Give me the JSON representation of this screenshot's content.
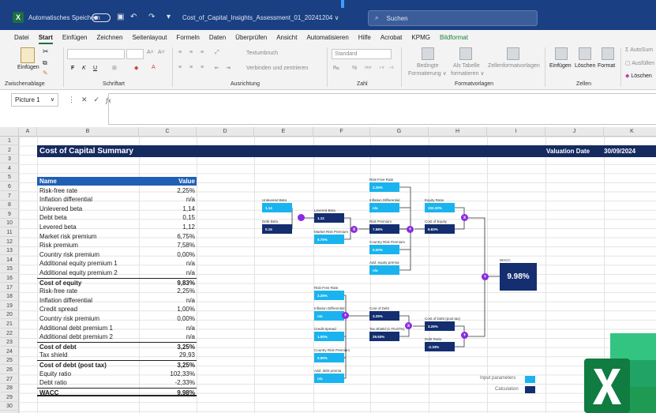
{
  "titlebar": {
    "logo": "X",
    "autosave_label": "Automatisches Speichern",
    "doc_name": "Cost_of_Capital_Insights_Assessment_01_20241204 ∨",
    "search_placeholder": "Suchen",
    "bg_color": "#1a3f82"
  },
  "menu": [
    "Datei",
    "Start",
    "Einfügen",
    "Zeichnen",
    "Seitenlayout",
    "Formeln",
    "Daten",
    "Überprüfen",
    "Ansicht",
    "Automatisieren",
    "Hilfe",
    "Acrobat",
    "KPMG",
    "Bildformat"
  ],
  "menu_active": "Start",
  "ribbon": {
    "paste": "Einfügen",
    "group_clipboard": "Zwischenablage",
    "group_font": "Schriftart",
    "group_align": "Ausrichtung",
    "group_number": "Zahl",
    "group_styles": "Formatvorlagen",
    "group_cells": "Zellen",
    "wrap_text": "Textumbruch",
    "merge": "Verbinden und zentrieren",
    "number_format": "Standard",
    "cond_format_1": "Bedingte",
    "cond_format_2": "Formatierung ∨",
    "as_table_1": "Als Tabelle",
    "as_table_2": "formatieren ∨",
    "cell_styles": "Zellenformatvorlagen",
    "insert": "Einfügen",
    "delete": "Löschen",
    "format": "Format",
    "autosum": "AutoSum",
    "fill": "Ausfüllen",
    "clear": "Löschen",
    "font_letters": {
      "bold": "F",
      "italic": "K",
      "underline": "U"
    }
  },
  "formula": {
    "name_box": "Picture 1",
    "fx": "fx"
  },
  "columns": [
    "A",
    "B",
    "C",
    "D",
    "E",
    "F",
    "G",
    "H",
    "I",
    "J",
    "K"
  ],
  "rows": [
    "1",
    "2",
    "3",
    "4",
    "5",
    "6",
    "7",
    "8",
    "9",
    "10",
    "11",
    "12",
    "13",
    "14",
    "15",
    "16",
    "17",
    "18",
    "19",
    "20",
    "21",
    "22",
    "23",
    "24",
    "25",
    "26",
    "27",
    "28",
    "29",
    "30"
  ],
  "sheet": {
    "title": "Cost of Capital Summary",
    "valuation_label": "Valuation Date",
    "valuation_date": "30/09/2024",
    "header_name": "Name",
    "header_value": "Value",
    "rows": [
      {
        "n": "Risk-free rate",
        "v": "2,25%"
      },
      {
        "n": "Inflation differential",
        "v": "n/a"
      },
      {
        "n": "Unlevered beta",
        "v": "1,14"
      },
      {
        "n": "Debt beta",
        "v": "0,15"
      },
      {
        "n": "Levered beta",
        "v": "1,12"
      },
      {
        "n": "Market risk premium",
        "v": "6,75%"
      },
      {
        "n": "Risk premium",
        "v": "7,58%"
      },
      {
        "n": "Country risk premium",
        "v": "0,00%"
      },
      {
        "n": "Additional equity premium 1",
        "v": "n/a"
      },
      {
        "n": "Additional equity premium 2",
        "v": "n/a"
      },
      {
        "n": "Cost of equity",
        "v": "9,83%",
        "bold": true
      },
      {
        "n": "Risk-free rate",
        "v": "2,25%"
      },
      {
        "n": "Inflation differential",
        "v": "n/a"
      },
      {
        "n": "Credit spread",
        "v": "1,00%"
      },
      {
        "n": "Country risk premium",
        "v": "0,00%"
      },
      {
        "n": "Additional debt premium 1",
        "v": "n/a"
      },
      {
        "n": "Additional debt premium 2",
        "v": "n/a"
      },
      {
        "n": "Cost of debt",
        "v": "3,25%",
        "bold": true
      },
      {
        "n": "Tax shield",
        "v": "29,93"
      },
      {
        "n": "Cost of debt (post tax)",
        "v": "3,25%",
        "bold": true
      },
      {
        "n": "Equity ratio",
        "v": "102,33%"
      },
      {
        "n": "Debt ratio",
        "v": "-2,33%"
      },
      {
        "n": "WACC",
        "v": "9,98%",
        "bold": true,
        "last": true
      }
    ]
  },
  "tree": {
    "boxes": [
      {
        "id": "unlev",
        "label": "Unlevered Beta",
        "value": "1.14",
        "kind": "input"
      },
      {
        "id": "debtbeta",
        "label": "Debt Beta",
        "value": "0.15",
        "kind": "calc"
      },
      {
        "id": "lev",
        "label": "Levered Beta",
        "value": "1.12",
        "kind": "calc"
      },
      {
        "id": "mrp",
        "label": "Market Risk Premium",
        "value": "6.75%",
        "kind": "input"
      },
      {
        "id": "rf1",
        "label": "Risk-Free Rate",
        "value": "2.25%",
        "kind": "input"
      },
      {
        "id": "infl1",
        "label": "Inflation Differential",
        "value": "n/a",
        "kind": "input"
      },
      {
        "id": "rp",
        "label": "Risk Premium",
        "value": "7.58%",
        "kind": "calc"
      },
      {
        "id": "crp1",
        "label": "Country Risk Premium",
        "value": "0.00%",
        "kind": "input"
      },
      {
        "id": "add1",
        "label": "Add. equity premia",
        "value": "n/a",
        "kind": "input"
      },
      {
        "id": "eqr",
        "label": "Equity Ratio",
        "value": "102.33%",
        "kind": "input"
      },
      {
        "id": "coe",
        "label": "Cost of Equity",
        "value": "9.83%",
        "kind": "calc"
      },
      {
        "id": "rf2",
        "label": "Risk-Free Rate",
        "value": "2.25%",
        "kind": "input"
      },
      {
        "id": "infl2",
        "label": "Inflation Differential",
        "value": "n/a",
        "kind": "input"
      },
      {
        "id": "cs",
        "label": "Credit Spread",
        "value": "1.00%",
        "kind": "input"
      },
      {
        "id": "crp2",
        "label": "Country Risk Premium",
        "value": "0.00%",
        "kind": "input"
      },
      {
        "id": "add2",
        "label": "Add. debt premia",
        "value": "n/a",
        "kind": "input"
      },
      {
        "id": "cod",
        "label": "Cost of Debt",
        "value": "3.25%",
        "kind": "calc"
      },
      {
        "id": "tax",
        "label": "Tax Shield (1-T0.07%)",
        "value": "29.93%",
        "kind": "calc"
      },
      {
        "id": "codpt",
        "label": "Cost of Debt (post tax)",
        "value": "3.25%",
        "kind": "calc"
      },
      {
        "id": "dr",
        "label": "Debt Ratio",
        "value": "-2.33%",
        "kind": "calc"
      }
    ],
    "wacc_label": "WACC",
    "wacc_value": "9.98%",
    "ops": [
      "",
      "x",
      "+",
      "x",
      "+",
      "x",
      "+",
      "+"
    ],
    "legend_input": "Input parameters",
    "legend_calc": "Calculation",
    "input_color": "#19b4ef",
    "calc_color": "#142e70",
    "op_color": "#8a2be2"
  }
}
